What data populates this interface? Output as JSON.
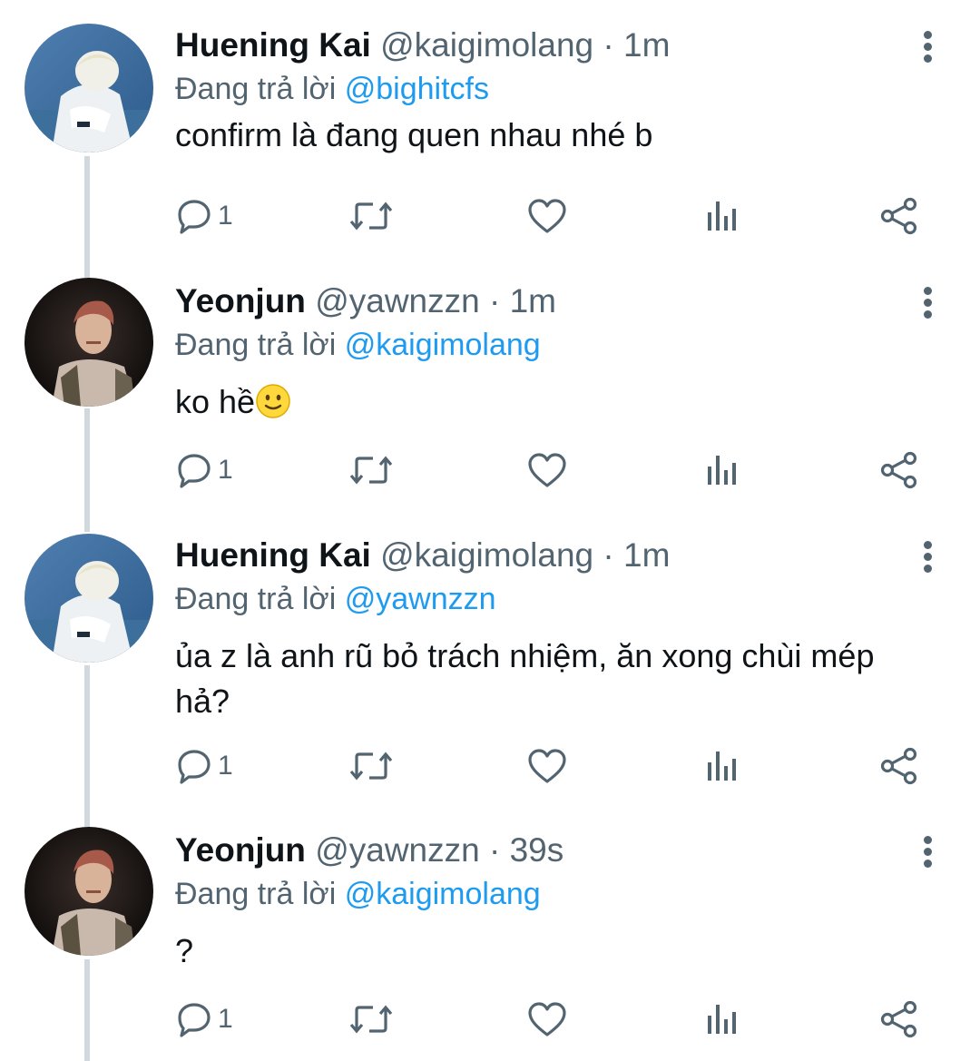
{
  "colors": {
    "text": "#0f1419",
    "secondary": "#536471",
    "link": "#1d9bf0",
    "thread_line": "#cfd9de"
  },
  "tweets": [
    {
      "name": "Huening Kai",
      "handle": "@kaigimolang",
      "separator": "·",
      "time": "1m",
      "replying_prefix": "Đang trả lời",
      "replying_to": "@bighitcfs",
      "text": "confirm là đang quen nhau nhé b",
      "reply_count": "1",
      "avatar": "huening-kai-avatar"
    },
    {
      "name": "Yeonjun",
      "handle": "@yawnzzn",
      "separator": "·",
      "time": "1m",
      "replying_prefix": "Đang trả lời",
      "replying_to": "@kaigimolang",
      "text": "ko hề",
      "text_emoji": "slightly-smiling-face-emoji",
      "reply_count": "1",
      "avatar": "yeonjun-avatar"
    },
    {
      "name": "Huening Kai",
      "handle": "@kaigimolang",
      "separator": "·",
      "time": "1m",
      "replying_prefix": "Đang trả lời",
      "replying_to": "@yawnzzn",
      "text": "ủa z là anh rũ bỏ trách nhiệm, ăn xong chùi mép hả?",
      "reply_count": "1",
      "avatar": "huening-kai-avatar"
    },
    {
      "name": "Yeonjun",
      "handle": "@yawnzzn",
      "separator": "·",
      "time": "39s",
      "replying_prefix": "Đang trả lời",
      "replying_to": "@kaigimolang",
      "text": "?",
      "reply_count": "1",
      "avatar": "yeonjun-avatar"
    }
  ],
  "icons": {
    "reply": "reply-icon",
    "retweet": "retweet-icon",
    "like": "heart-icon",
    "stats": "analytics-icon",
    "share": "share-icon",
    "more": "more-vertical-icon"
  }
}
